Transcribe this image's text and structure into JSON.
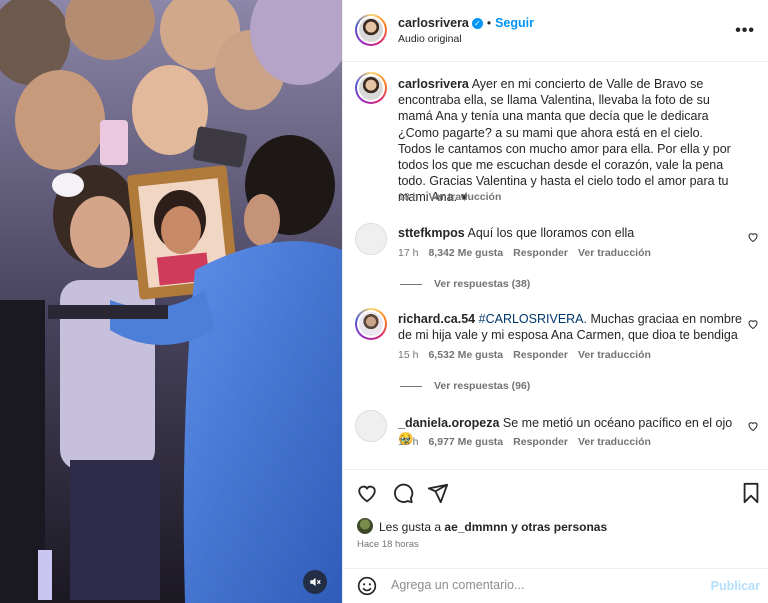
{
  "post": {
    "author": "carlosrivera",
    "verified_icon": "verified-badge-icon",
    "follow_label": "Seguir",
    "separator": "•",
    "audio_label": "Audio original",
    "more_icon": "more-options-icon",
    "more_label": "•••"
  },
  "caption": {
    "username": "carlosrivera",
    "text": "Ayer en mi concierto de Valle de Bravo se encontraba ella, se llama Valentina, llevaba la foto de su mamá Ana y tenía una manta que decía que le dedicara ¿Como pagarte? a su mami que ahora está en el cielo. Todos le cantamos con mucho amor para ella. Por ella y por todos los que me escuchan desde el corazón, vale la pena todo. Gracias Valentina y hasta el cielo todo el amor para tu mami Ana. ♥",
    "time": "18 h",
    "translate_label": "Ver traducción"
  },
  "comments": [
    {
      "username": "sttefkmpos",
      "text": "Aquí los que lloramos con ella",
      "time": "17 h",
      "likes": "8,342 Me gusta",
      "reply_label": "Responder",
      "translate_label": "Ver traducción",
      "replies_label": "Ver respuestas (38)"
    },
    {
      "username": "richard.ca.54",
      "hashtag": "#CARLOSRIVERA.",
      "text": "Muchas graciaa en nombre de mi hija vale y mi esposa Ana Carmen, que dioa te bendiga",
      "time": "15 h",
      "likes": "6,532 Me gusta",
      "reply_label": "Responder",
      "translate_label": "Ver traducción",
      "replies_label": "Ver respuestas (96)"
    },
    {
      "username": "_daniela.oropeza",
      "text": "Se me metió un océano pacífico en el ojo 🥹",
      "time": "18 h",
      "likes": "6,977 Me gusta",
      "reply_label": "Responder",
      "translate_label": "Ver traducción"
    }
  ],
  "actions": {
    "like_icon": "heart-icon",
    "comment_icon": "comment-icon",
    "share_icon": "share-icon",
    "save_icon": "bookmark-icon",
    "likes_prefix": "Les gusta a",
    "likes_user": "ae_dmmnn",
    "likes_suffix": "y otras personas",
    "posted_time": "Hace 18 horas"
  },
  "comment_box": {
    "emoji_icon": "emoji-icon",
    "placeholder": "Agrega un comentario...",
    "publish_label": "Publicar"
  },
  "media": {
    "mute_icon": "mute-icon"
  },
  "colors": {
    "accent": "#0095f6",
    "hashtag": "#00376b",
    "publish_disabled": "#b2dffc",
    "muted_text": "#737373"
  }
}
